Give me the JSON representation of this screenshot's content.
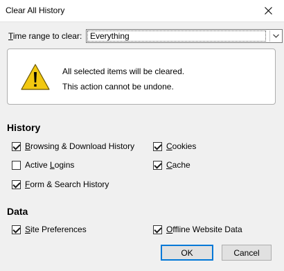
{
  "window": {
    "title": "Clear All History"
  },
  "time_range": {
    "label_mnemonic": "T",
    "label_rest": "ime range to clear:",
    "selected": "Everything"
  },
  "warning": {
    "line1": "All selected items will be cleared.",
    "line2": "This action cannot be undone."
  },
  "history": {
    "heading": "History",
    "items": [
      {
        "pre": "",
        "mn": "B",
        "post": "rowsing & Download History",
        "checked": true
      },
      {
        "pre": "",
        "mn": "C",
        "post": "ookies",
        "checked": true
      },
      {
        "pre": "Active ",
        "mn": "L",
        "post": "ogins",
        "checked": false
      },
      {
        "pre": "",
        "mn": "C",
        "post": "ache",
        "checked": true
      },
      {
        "pre": "",
        "mn": "F",
        "post": "orm & Search History",
        "checked": true
      }
    ]
  },
  "data": {
    "heading": "Data",
    "items": [
      {
        "pre": "",
        "mn": "S",
        "post": "ite Preferences",
        "checked": true
      },
      {
        "pre": "",
        "mn": "O",
        "post": "ffline Website Data",
        "checked": true
      }
    ]
  },
  "buttons": {
    "ok": "OK",
    "cancel": "Cancel"
  },
  "colors": {
    "accent": "#0078d7",
    "warning_yellow": "#f2c811"
  },
  "icons": {
    "close": "close-icon",
    "dropdown": "chevron-down-icon",
    "warning": "warning-icon"
  }
}
